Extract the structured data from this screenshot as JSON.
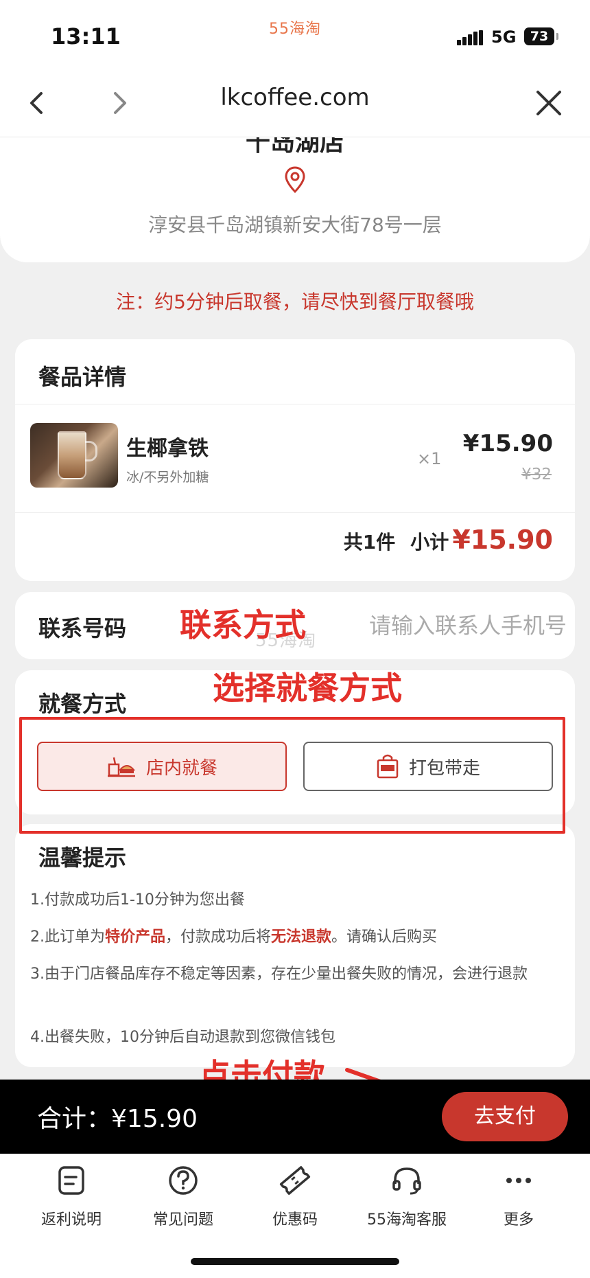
{
  "status": {
    "time": "13:11",
    "app_brand": "55海淘",
    "network": "5G",
    "battery": "73"
  },
  "nav": {
    "url": "lkcoffee.com"
  },
  "store": {
    "name": "千岛湖店",
    "address": "淳安县千岛湖镇新安大街78号一层"
  },
  "notice": "注：约5分钟后取餐，请尽快到餐厅取餐哦",
  "order": {
    "title": "餐品详情",
    "items": [
      {
        "name": "生椰拿铁",
        "spec": "冰/不另外加糖",
        "qty": "×1",
        "price": "¥15.90",
        "original_price": "¥32"
      }
    ],
    "count_text": "共1件",
    "subtotal_label": "小计",
    "subtotal": "¥15.90"
  },
  "contact": {
    "label": "联系号码",
    "placeholder": "请输入联系人手机号",
    "value": ""
  },
  "watermark": "55海淘",
  "dining": {
    "title": "就餐方式",
    "options": [
      "店内就餐",
      "打包带走"
    ],
    "selected": "店内就餐"
  },
  "tips": {
    "title": "温馨提示",
    "line1": "1.付款成功后1-10分钟为您出餐",
    "line2_a": "2.此订单为",
    "line2_b": "特价产品",
    "line2_c": "，付款成功后将",
    "line2_d": "无法退款",
    "line2_e": "。请确认后购买",
    "line3": "3.由于门店餐品库存不稳定等因素，存在少量出餐失败的情况，会进行退款",
    "line4": "4.出餐失败，10分钟后自动退款到您微信钱包"
  },
  "annotations": {
    "contact": "联系方式",
    "dining": "选择就餐方式",
    "pay": "点击付款"
  },
  "pay": {
    "total_label": "合计：",
    "total": "¥15.90",
    "button": "去支付"
  },
  "tabs": [
    {
      "label": "返利说明",
      "icon": "document-icon"
    },
    {
      "label": "常见问题",
      "icon": "question-icon"
    },
    {
      "label": "优惠码",
      "icon": "coupon-icon"
    },
    {
      "label": "55海淘客服",
      "icon": "headset-icon"
    },
    {
      "label": "更多",
      "icon": "more-icon"
    }
  ],
  "colors": {
    "accent": "#c8372d",
    "annotation": "#e3302a"
  }
}
